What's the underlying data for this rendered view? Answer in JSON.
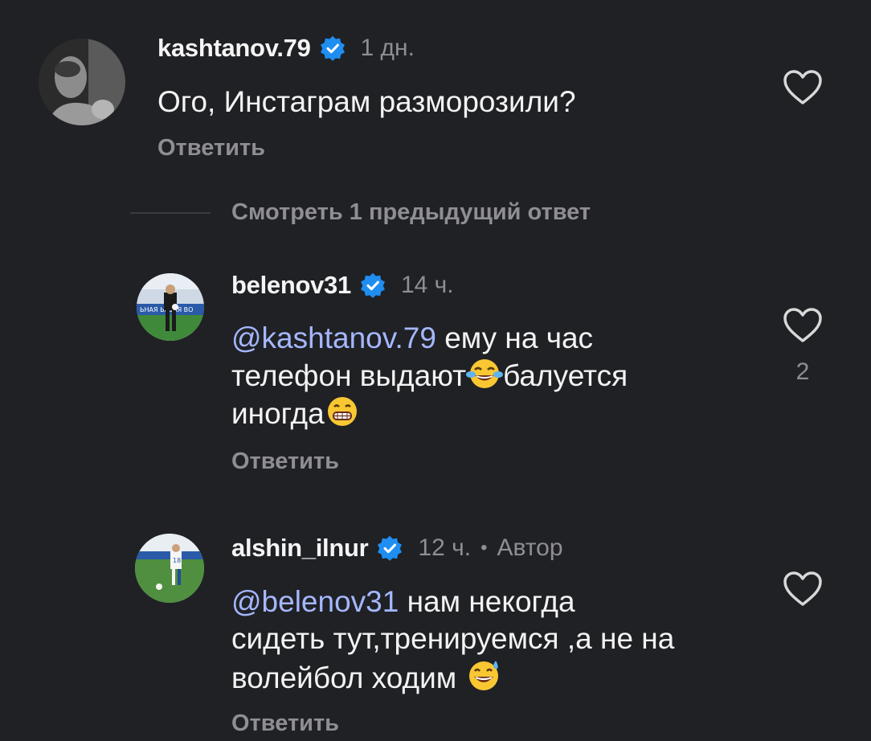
{
  "comments": [
    {
      "username": "kashtanov.79",
      "time": "1 дн.",
      "text": "Ого, Инстаграм разморозили?",
      "reply_label": "Ответить",
      "like_count": ""
    },
    {
      "username": "belenov31",
      "time": "14 ч.",
      "mention": "@kashtanov.79",
      "text_line1": " ему на час",
      "text_line2a": "телефон выдают",
      "text_line2b": "балуется",
      "text_line3": "иногда",
      "reply_label": "Ответить",
      "like_count": "2"
    },
    {
      "username": "alshin_ilnur",
      "time": "12 ч.",
      "separator": "•",
      "author_badge": "Автор",
      "mention": "@belenov31",
      "text_line1": " нам некогда",
      "text_line2": "сидеть тут,тренируемся ,а не на",
      "text_line3": "волейбол ходим ",
      "reply_label": "Ответить",
      "like_count": ""
    }
  ],
  "view_previous": "Смотреть 1 предыдущий ответ",
  "icons": {
    "verified": "verified-badge-icon",
    "like": "heart-outline-icon",
    "emoji_tears": "face-with-tears-of-joy-icon",
    "emoji_grin": "grinning-face-icon",
    "emoji_sweat": "grinning-face-with-sweat-icon"
  },
  "colors": {
    "background": "#202125",
    "secondary_text": "#8e8e93",
    "mention": "#a5b7ff",
    "verified": "#1f8ef1"
  }
}
